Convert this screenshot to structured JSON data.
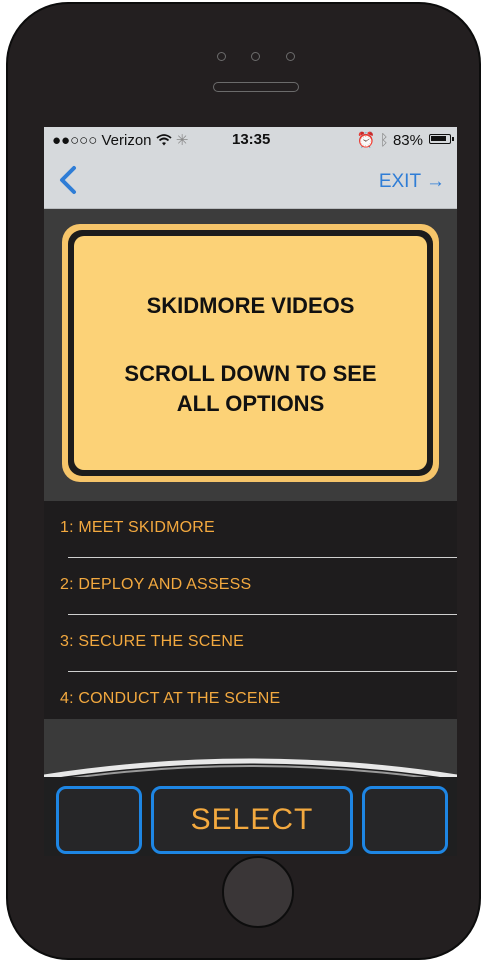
{
  "status_bar": {
    "carrier": "●●○○○ Verizon",
    "time": "13:35",
    "battery": "83%"
  },
  "nav": {
    "exit_label": "EXIT →"
  },
  "sign": {
    "title": "SKIDMORE VIDEOS",
    "subtitle_line1": "SCROLL DOWN TO SEE",
    "subtitle_line2": "ALL OPTIONS"
  },
  "menu": {
    "items": [
      {
        "label": "1: MEET SKIDMORE"
      },
      {
        "label": "2: DEPLOY AND ASSESS"
      },
      {
        "label": "3: SECURE THE SCENE"
      },
      {
        "label": "4: CONDUCT AT THE SCENE"
      }
    ]
  },
  "controls": {
    "select_label": "SELECT"
  },
  "colors": {
    "accent_blue": "#1e86e4",
    "menu_text": "#f3a93f",
    "sign_yellow": "#fcd277",
    "link_blue": "#2f7dd6"
  },
  "icons": {
    "back": "chevron-left-icon",
    "wifi": "wifi-icon",
    "alarm": "alarm-icon",
    "bluetooth": "bluetooth-icon",
    "battery": "battery-icon"
  }
}
